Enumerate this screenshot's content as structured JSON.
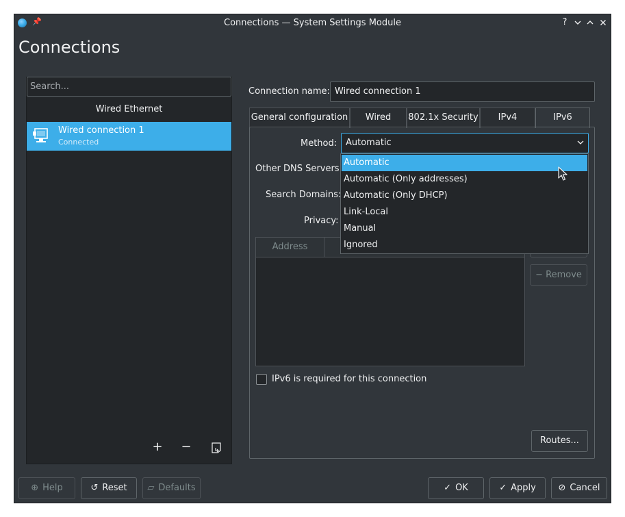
{
  "window": {
    "title": "Connections — System Settings Module",
    "controls": [
      "?",
      "⌄",
      "⌃",
      "✕"
    ]
  },
  "page": {
    "title": "Connections"
  },
  "left": {
    "search_placeholder": "Search...",
    "group_header": "Wired Ethernet",
    "connections": [
      {
        "name": "Wired connection 1",
        "status": "Connected",
        "icon": "network-wired-icon"
      }
    ],
    "actions": {
      "add": "+",
      "remove": "−",
      "import": "import-icon"
    }
  },
  "form": {
    "connection_name_label": "Connection name:",
    "connection_name_value": "Wired connection 1",
    "tabs": [
      {
        "label": "General configuration",
        "active": false
      },
      {
        "label": "Wired",
        "active": false
      },
      {
        "label": "802.1x Security",
        "active": false
      },
      {
        "label": "IPv4",
        "active": false
      },
      {
        "label": "IPv6",
        "active": true
      }
    ],
    "method_label": "Method:",
    "method_value": "Automatic",
    "other_dns_label": "Other DNS Servers:",
    "search_domains_label": "Search Domains:",
    "privacy_label": "Privacy:",
    "address_column": "Address",
    "remove_label": "Remove",
    "ipv6_required_label": "IPv6 is required for this connection",
    "ipv6_required_checked": false,
    "routes_label": "Routes...",
    "method_options": [
      {
        "label": "Automatic",
        "selected": true
      },
      {
        "label": "Automatic (Only addresses)",
        "selected": false
      },
      {
        "label": "Automatic (Only DHCP)",
        "selected": false
      },
      {
        "label": "Link-Local",
        "selected": false
      },
      {
        "label": "Manual",
        "selected": false
      },
      {
        "label": "Ignored",
        "selected": false
      }
    ]
  },
  "footer": {
    "help": "Help",
    "reset": "Reset",
    "defaults": "Defaults",
    "ok": "OK",
    "apply": "Apply",
    "cancel": "Cancel"
  },
  "colors": {
    "window_bg": "#31363b",
    "view_bg": "#232629",
    "accent": "#3daee9",
    "text": "#eff0f1",
    "disabled_text": "#7f8c8d"
  }
}
